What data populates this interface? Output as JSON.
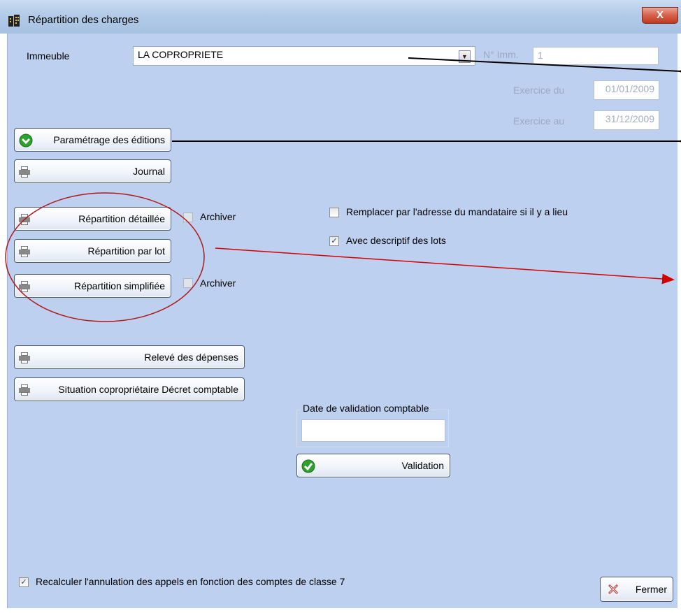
{
  "window": {
    "title": "Répartition des charges",
    "close_glyph": "X"
  },
  "header": {
    "immeuble_label": "Immeuble",
    "immeuble_value": "LA COPROPRIETE",
    "num_imm_label": "N° Imm.",
    "num_imm_value": "1",
    "exercice_du_label": "Exercice du",
    "exercice_du_value": "01/01/2009",
    "exercice_au_label": "Exercice au",
    "exercice_au_value": "31/12/2009"
  },
  "buttons": {
    "parametrage": "Paramétrage des éditions",
    "journal": "Journal",
    "repartition_detaillee": "Répartition détaillée",
    "repartition_par_lot": "Répartition par lot",
    "repartition_simplifiee": "Répartition simplifiée",
    "releve_depenses": "Relevé des dépenses",
    "situation_coproprietaire": "Situation copropriétaire Décret comptable",
    "validation": "Validation",
    "fermer": "Fermer"
  },
  "checkboxes": {
    "archiver_1": {
      "label": "Archiver",
      "checked": false
    },
    "archiver_2": {
      "label": "Archiver",
      "checked": false
    },
    "remplacer_adresse": {
      "label": "Remplacer par l'adresse du mandataire si il y a lieu",
      "checked": false
    },
    "avec_descriptif": {
      "label": "Avec descriptif des lots",
      "checked": true
    },
    "recalculer": {
      "label": "Recalculer l'annulation des appels en fonction des comptes de classe 7",
      "checked": true
    }
  },
  "validation_group": {
    "title": "Date de validation comptable",
    "date_value": ""
  },
  "icons": {
    "window": "building-icon",
    "close": "close-icon",
    "combo": "chevron-down-icon",
    "parametrage": "green-arrow-icon",
    "print": "printer-icon",
    "validation": "green-check-icon",
    "fermer": "red-cross-icon",
    "checkmark": "✓"
  },
  "colors": {
    "panel": "#bdd0ef",
    "titlebar": "#b3cbe8",
    "close": "#c0391f",
    "annotation_black": "#000000",
    "annotation_red": "#d40000"
  }
}
